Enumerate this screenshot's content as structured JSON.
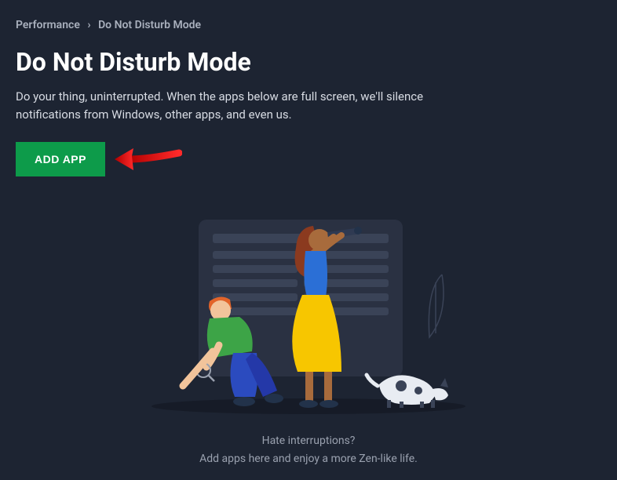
{
  "breadcrumb": {
    "root": "Performance",
    "current": "Do Not Disturb Mode"
  },
  "title": "Do Not Disturb Mode",
  "description": "Do your thing, uninterrupted. When the apps below are full screen, we'll silence notifications from Windows, other apps, and even us.",
  "add_button_label": "ADD APP",
  "empty_state": {
    "line1": "Hate interruptions?",
    "line2": "Add apps here and enjoy a more Zen-like life."
  },
  "colors": {
    "bg": "#1d2432",
    "button": "#0d9b4a",
    "arrow": "#d11a1a"
  }
}
